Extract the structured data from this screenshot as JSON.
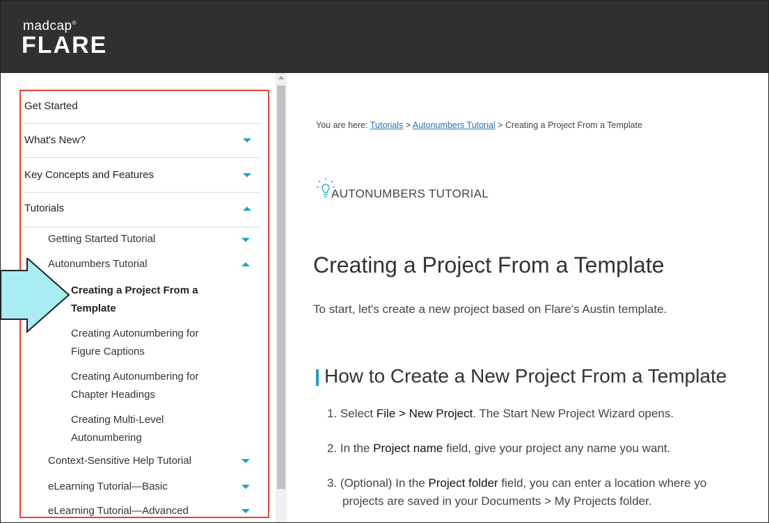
{
  "header": {
    "logo_small": "madcap",
    "logo_big": "FLARE"
  },
  "sidebar": {
    "items": [
      {
        "label": "Get Started"
      },
      {
        "label": "What's New?"
      },
      {
        "label": "Key Concepts and Features"
      },
      {
        "label": "Tutorials"
      }
    ],
    "tutorials": [
      {
        "label": "Getting Started Tutorial"
      },
      {
        "label": "Autonumbers Tutorial"
      },
      {
        "label": "Context-Sensitive Help Tutorial"
      },
      {
        "label": "eLearning Tutorial—Basic"
      },
      {
        "label": "eLearning Tutorial—Advanced"
      }
    ],
    "autonumbers": [
      {
        "line1": "Creating a Project From a",
        "line2": "Template"
      },
      {
        "line1": "Creating Autonumbering for",
        "line2": "Figure Captions"
      },
      {
        "line1": "Creating Autonumbering for",
        "line2": "Chapter Headings"
      },
      {
        "line1": "Creating Multi-Level",
        "line2": "Autonumbering"
      }
    ]
  },
  "main": {
    "breadcrumb": {
      "prefix": "You are here: ",
      "link1": "Tutorials",
      "sep1": " > ",
      "link2": "Autonumbers Tutorial",
      "sep2": " > ",
      "current": "Creating a Project From a Template"
    },
    "tutorial_label": "AUTONUMBERS TUTORIAL",
    "title": "Creating a Project From a Template",
    "intro": "To start, let's create a new project based on Flare's Austin template.",
    "h2": "How to Create a New Project From a Template",
    "steps": [
      {
        "num": "1. ",
        "pre": "Select ",
        "bold": "File > New Project",
        "post": ". The Start New Project Wizard opens."
      },
      {
        "num": "2. ",
        "pre": "In the ",
        "bold": "Project name",
        "post": " field, give your project any name you want."
      },
      {
        "num": "3. ",
        "pre": "(Optional) In the ",
        "bold": "Project folder",
        "post": " field, you can enter a location where yo",
        "line2": "projects are saved in your Documents > My Projects folder."
      }
    ]
  },
  "colors": {
    "header_bg": "#2e3032",
    "accent": "#1ba3c7",
    "highlight_box": "#e0452e",
    "callout_fill": "#a9ecf2"
  }
}
